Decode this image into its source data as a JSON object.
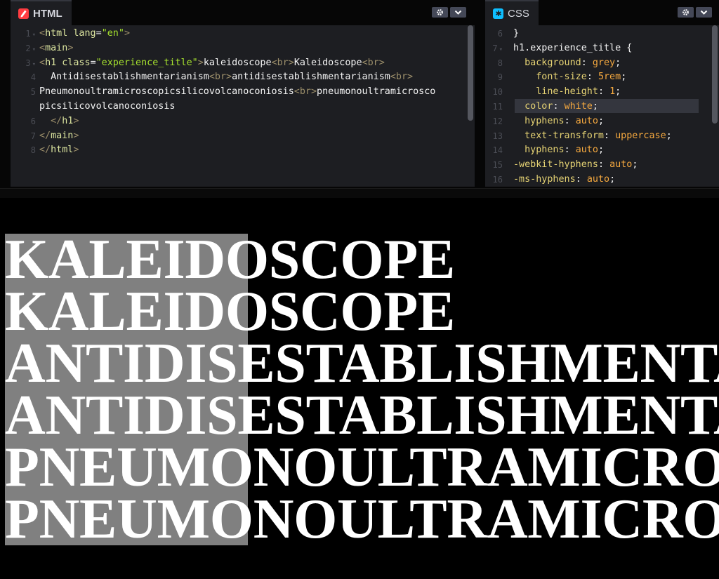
{
  "html_panel": {
    "title": "HTML",
    "buttons": [
      "settings",
      "collapse"
    ],
    "lines": [
      {
        "num": "1",
        "fold": true,
        "parts": [
          [
            "tagb",
            "<"
          ],
          [
            "tag",
            "html "
          ],
          [
            "attr",
            "lang"
          ],
          [
            "plain",
            "="
          ],
          [
            "str",
            "\"en\""
          ],
          [
            "tagb",
            ">"
          ]
        ]
      },
      {
        "num": "2",
        "fold": true,
        "parts": [
          [
            "tagb",
            "<"
          ],
          [
            "tag",
            "main"
          ],
          [
            "tagb",
            ">"
          ]
        ]
      },
      {
        "num": "3",
        "fold": true,
        "parts": [
          [
            "tagb",
            "<"
          ],
          [
            "tag",
            "h1 "
          ],
          [
            "attr",
            "class"
          ],
          [
            "plain",
            "="
          ],
          [
            "str",
            "\"experience_title\""
          ],
          [
            "tagb",
            ">"
          ],
          [
            "plain",
            "kaleidoscope"
          ],
          [
            "tagb",
            "<br>"
          ],
          [
            "plain",
            "Kaleidoscope"
          ],
          [
            "tagb",
            "<br>"
          ]
        ]
      },
      {
        "num": "4",
        "fold": false,
        "parts": [
          [
            "plain",
            "  Antidisestablishmentarianism"
          ],
          [
            "tagb",
            "<br>"
          ],
          [
            "plain",
            "antidisestablishmentarianism"
          ],
          [
            "tagb",
            "<br>"
          ]
        ]
      },
      {
        "num": "5",
        "fold": false,
        "parts": [
          [
            "plain",
            "Pneumonoultramicroscopicsilicovolcanoconiosis"
          ],
          [
            "tagb",
            "<br>"
          ],
          [
            "plain",
            "pneumonoultramicrosco"
          ]
        ]
      },
      {
        "num": "",
        "fold": false,
        "parts": [
          [
            "plain",
            "picsilicovolcanoconiosis"
          ]
        ]
      },
      {
        "num": "6",
        "fold": false,
        "parts": [
          [
            "plain",
            "  "
          ],
          [
            "tagb",
            "</"
          ],
          [
            "tag",
            "h1"
          ],
          [
            "tagb",
            ">"
          ]
        ]
      },
      {
        "num": "7",
        "fold": false,
        "parts": [
          [
            "tagb",
            "</"
          ],
          [
            "tag",
            "main"
          ],
          [
            "tagb",
            ">"
          ]
        ]
      },
      {
        "num": "8",
        "fold": false,
        "parts": [
          [
            "tagb",
            "</"
          ],
          [
            "tag",
            "html"
          ],
          [
            "tagb",
            ">"
          ]
        ]
      }
    ]
  },
  "css_panel": {
    "title": "CSS",
    "buttons": [
      "settings",
      "collapse"
    ],
    "lines": [
      {
        "num": "6",
        "fold": false,
        "parts": [
          [
            "plain",
            "}"
          ]
        ]
      },
      {
        "num": "7",
        "fold": true,
        "parts": [
          [
            "sel",
            "h1.experience_title "
          ],
          [
            "plain",
            "{"
          ]
        ]
      },
      {
        "num": "8",
        "fold": false,
        "parts": [
          [
            "plain",
            "  "
          ],
          [
            "prop",
            "background"
          ],
          [
            "plain",
            ": "
          ],
          [
            "val",
            "grey"
          ],
          [
            "plain",
            ";"
          ]
        ]
      },
      {
        "num": "9",
        "fold": false,
        "parts": [
          [
            "plain",
            "    "
          ],
          [
            "prop",
            "font-size"
          ],
          [
            "plain",
            ": "
          ],
          [
            "val",
            "5rem"
          ],
          [
            "plain",
            ";"
          ]
        ]
      },
      {
        "num": "10",
        "fold": false,
        "parts": [
          [
            "plain",
            "    "
          ],
          [
            "prop",
            "line-height"
          ],
          [
            "plain",
            ": "
          ],
          [
            "val",
            "1"
          ],
          [
            "plain",
            ";"
          ]
        ]
      },
      {
        "num": "11",
        "fold": false,
        "parts": [
          [
            "plain",
            "  "
          ],
          [
            "prop",
            "color"
          ],
          [
            "plain",
            ": "
          ],
          [
            "val",
            "white"
          ],
          [
            "plain",
            ";"
          ]
        ]
      },
      {
        "num": "12",
        "fold": false,
        "parts": [
          [
            "plain",
            "  "
          ],
          [
            "prop",
            "hyphens"
          ],
          [
            "plain",
            ": "
          ],
          [
            "val",
            "auto"
          ],
          [
            "plain",
            ";"
          ]
        ]
      },
      {
        "num": "13",
        "fold": false,
        "parts": [
          [
            "plain",
            "  "
          ],
          [
            "prop",
            "text-transform"
          ],
          [
            "plain",
            ": "
          ],
          [
            "val",
            "uppercase"
          ],
          [
            "plain",
            ";"
          ]
        ]
      },
      {
        "num": "14",
        "fold": false,
        "parts": [
          [
            "plain",
            "  "
          ],
          [
            "prop",
            "hyphens"
          ],
          [
            "plain",
            ": "
          ],
          [
            "val",
            "auto"
          ],
          [
            "plain",
            ";"
          ]
        ]
      },
      {
        "num": "15",
        "fold": false,
        "parts": [
          [
            "prop",
            "-webkit-hyphens"
          ],
          [
            "plain",
            ": "
          ],
          [
            "val",
            "auto"
          ],
          [
            "plain",
            ";"
          ]
        ]
      },
      {
        "num": "16",
        "fold": false,
        "parts": [
          [
            "prop",
            "-ms-hyphens"
          ],
          [
            "plain",
            ": "
          ],
          [
            "val",
            "auto"
          ],
          [
            "plain",
            ";"
          ]
        ]
      }
    ]
  },
  "preview": {
    "heading_words": [
      "kaleidoscope",
      "Kaleidoscope",
      "Antidisestablishmentarianism",
      "antidisestablishmentarianism",
      "Pneumonoultramicroscopicsilicovolcanoconiosis",
      "pneumonoultramicroscopicsilicovolcanoconiosis"
    ],
    "heading_background": "#808080",
    "heading_color": "#ffffff"
  },
  "colors": {
    "html_badge": "#ff3c41",
    "css_badge": "#0ebeff",
    "editor_bg": "#1d1e22"
  }
}
